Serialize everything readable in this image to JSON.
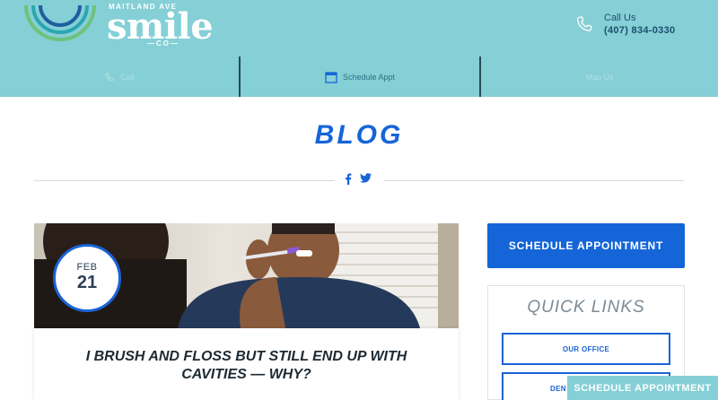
{
  "brand": {
    "top_line": "MAITLAND AVE",
    "main": "smile",
    "bottom_line": "CO"
  },
  "contact": {
    "label": "Call Us",
    "phone": "(407) 834-0330"
  },
  "nav": {
    "items": [
      {
        "label": "Call",
        "icon": "phone-icon"
      },
      {
        "label": "Schedule Appt",
        "icon": "calendar-icon"
      },
      {
        "label": "Map Us",
        "icon": "map-icon"
      }
    ]
  },
  "page": {
    "title": "BLOG"
  },
  "social": {
    "icons": [
      "facebook-icon",
      "twitter-icon"
    ]
  },
  "post": {
    "month": "FEB",
    "day": "21",
    "title": "I BRUSH AND FLOSS BUT STILL END UP WITH CAVITIES — WHY?"
  },
  "sidebar": {
    "schedule_label": "SCHEDULE APPOINTMENT",
    "quick_links_title": "QUICK LINKS",
    "links": [
      "OUR OFFICE",
      "DEN"
    ]
  },
  "sticky": {
    "label": "SCHEDULE APPOINTMENT"
  },
  "colors": {
    "header_bg": "#85cfd6",
    "accent_blue": "#1565d8",
    "dark_text": "#1e2a33"
  }
}
